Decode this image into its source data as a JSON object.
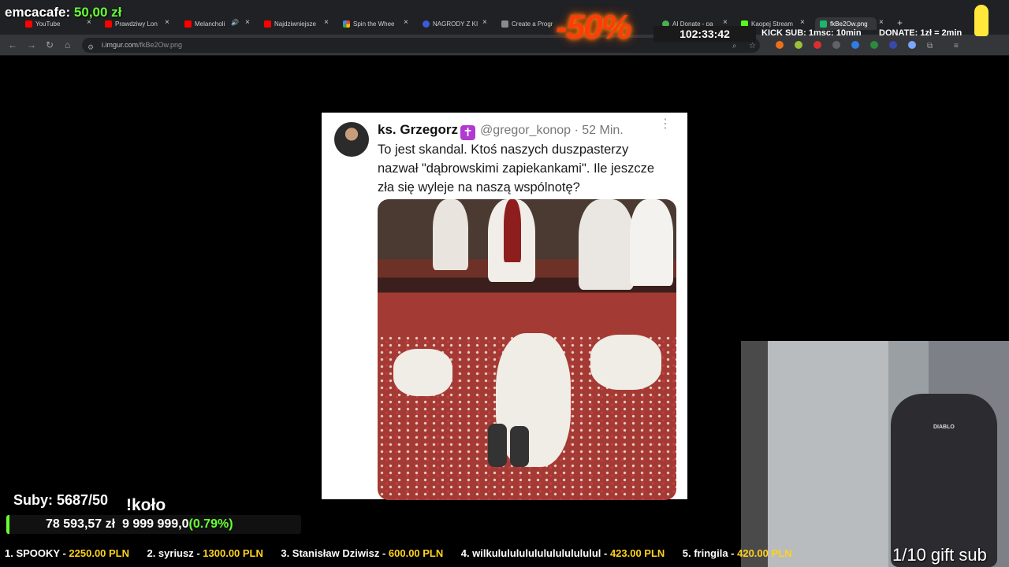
{
  "browser": {
    "tabs": [
      {
        "label": "YouTube",
        "color": "#ff0000"
      },
      {
        "label": "Prawdziwy Lon",
        "color": "#ff0000"
      },
      {
        "label": "Melancholi",
        "color": "#ff0000"
      },
      {
        "label": "Najdziwniejsze",
        "color": "#ff0000"
      },
      {
        "label": "Spin the Whee",
        "color": "#4285f4"
      },
      {
        "label": "NAGRODY Z KI",
        "color": "#3b5bdb"
      },
      {
        "label": "Create a Progr",
        "color": "#8a8a8a"
      },
      {
        "label": "AI Donate - pa",
        "color": "#4caf50"
      },
      {
        "label": "Kaopej Stream",
        "color": "#53fc18"
      },
      {
        "label": "fkBe2Ow.png",
        "color": "#1bb76e"
      }
    ],
    "url_host": "i.imgur.com",
    "url_path": "/fkBe2Ow.png"
  },
  "overlay": {
    "streamer": "emcacafe:",
    "last_donation": "50,00 zł",
    "timer": "102:33:42",
    "kick_sub": "KICK SUB: 1msc: 10min",
    "donate_rate": "DONATE: 1zł = 2min",
    "promo": "-50%",
    "subs": "Suby: 5687/50",
    "command": "!koło",
    "goal_current": "78 593,57 zł",
    "goal_target": "9 999 999,0",
    "goal_percent": "(0.79%)",
    "goal_fraction": 0.0079,
    "gift_sub": "1/10 gift sub",
    "webcam_chair_brand": "DIABLO",
    "leaderboard": [
      {
        "rank_name": "1. SPOOKY - ",
        "amount": "2250.00 PLN"
      },
      {
        "rank_name": "2. syriusz - ",
        "amount": "1300.00 PLN"
      },
      {
        "rank_name": "3. Stanisław Dziwisz - ",
        "amount": "600.00 PLN"
      },
      {
        "rank_name": "4. wilkulululululululululululul - ",
        "amount": "423.00 PLN"
      },
      {
        "rank_name": "5. fringila - ",
        "amount": "420.00 PLN"
      }
    ]
  },
  "post": {
    "author": "ks. Grzegorz",
    "badge": "✝",
    "handle": "@gregor_konop · 52 Min.",
    "text": "To jest skandal. Ktoś naszych duszpasterzy nazwał \"dąbrowskimi zapiekankami\". Ile jeszcze zła się wyleje na naszą wspólnotę?"
  }
}
